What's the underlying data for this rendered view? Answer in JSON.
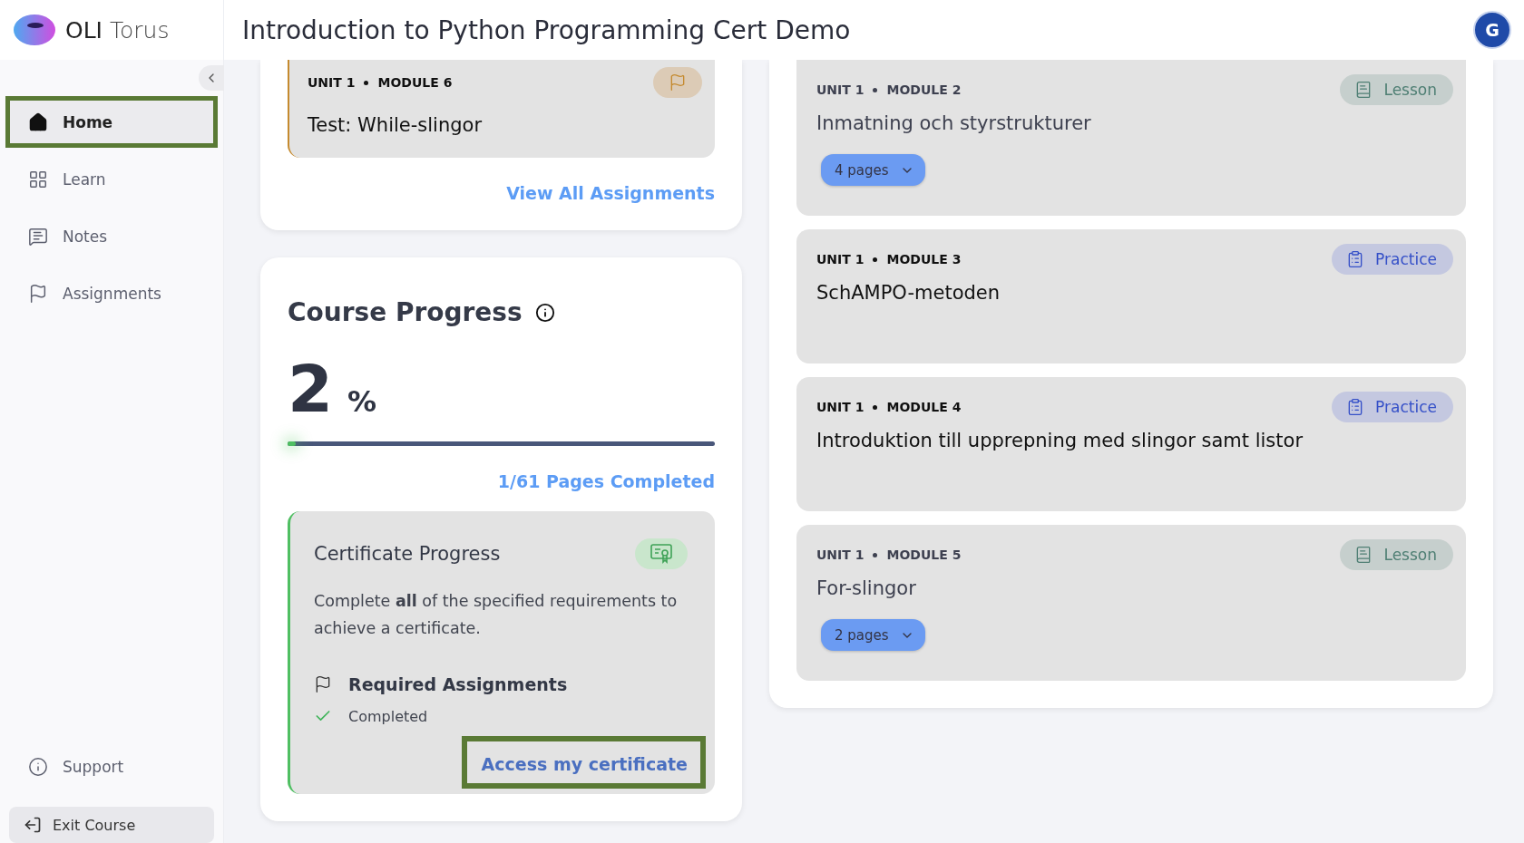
{
  "brand": {
    "name_bold": "OLI",
    "name_light": "Torus"
  },
  "header": {
    "title": "Introduction to Python Programming Cert Demo",
    "avatar": "G"
  },
  "sidebar": {
    "items": [
      {
        "label": "Home",
        "selected": true,
        "highlighted": true
      },
      {
        "label": "Learn",
        "selected": false,
        "highlighted": false
      },
      {
        "label": "Notes",
        "selected": false,
        "highlighted": false
      },
      {
        "label": "Assignments",
        "selected": false,
        "highlighted": false
      }
    ],
    "support": "Support",
    "exit": "Exit Course"
  },
  "assignments": {
    "items": [
      {
        "unit": "UNIT 1",
        "module": "MODULE 6",
        "title": "Test: While-slingor"
      }
    ],
    "view_all": "View All Assignments"
  },
  "course_progress": {
    "title": "Course Progress",
    "percent": "2",
    "unit": "%",
    "level": 0.02,
    "pages": "1/61 Pages Completed"
  },
  "certificate": {
    "title": "Certificate Progress",
    "description": "Complete **all** of the specified requirements to achieve a certificate.",
    "requirement": "Required Assignments",
    "status": "Completed",
    "completed": true,
    "button": "Access my certificate",
    "button_highlighted": true
  },
  "modules": [
    {
      "unit": "UNIT 1",
      "module": "MODULE 2",
      "title": "Inmatning och styrstrukturer",
      "kind": "lesson",
      "badge": "Lesson",
      "pages": "4 pages"
    },
    {
      "unit": "UNIT 1",
      "module": "MODULE 3",
      "title": "SchAMPO-metoden",
      "kind": "practice",
      "badge": "Practice"
    },
    {
      "unit": "UNIT 1",
      "module": "MODULE 4",
      "title": "Introduktion till upprepning med slingor samt listor",
      "kind": "practice",
      "badge": "Practice"
    },
    {
      "unit": "UNIT 1",
      "module": "MODULE 5",
      "title": "For-slingor",
      "kind": "lesson",
      "badge": "Lesson",
      "pages": "2 pages"
    }
  ]
}
